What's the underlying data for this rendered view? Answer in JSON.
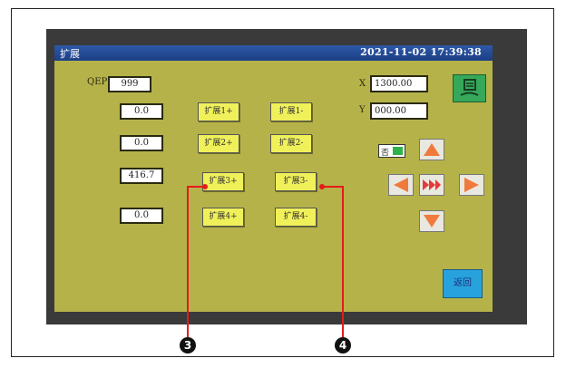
{
  "title": "扩展",
  "datetime": "2021-11-02 17:39:38",
  "qep_label": "QEP",
  "qep_value": "999",
  "values": [
    "0.0",
    "0.0",
    "416.7",
    "0.0"
  ],
  "buttons_plus": [
    "扩展1+",
    "扩展2+",
    "扩展3+",
    "扩展4+"
  ],
  "buttons_minus": [
    "扩展1-",
    "扩展2-",
    "扩展3-",
    "扩展4-"
  ],
  "x_label": "X",
  "x_value": "1300.00",
  "y_label": "Y",
  "y_value": "000.00",
  "toggle_text": "否",
  "return_label": "返回",
  "callouts": [
    "3",
    "4"
  ],
  "colors": {
    "screen_bg": "#b5b24a",
    "button_yellow": "#f0f05a",
    "titlebar_blue": "#2e58a8",
    "arrow_orange": "#f07a3c",
    "arrow_red": "#e33a3a",
    "led_green": "#2db34a",
    "callout_red": "#e31c1c"
  },
  "icons": {
    "arrow_up": "triangle-up-icon",
    "arrow_down": "triangle-down-icon",
    "arrow_left": "triangle-left-icon",
    "arrow_right": "triangle-right-icon",
    "fast_forward": "fast-forward-icon",
    "presser": "presser-foot-icon"
  }
}
